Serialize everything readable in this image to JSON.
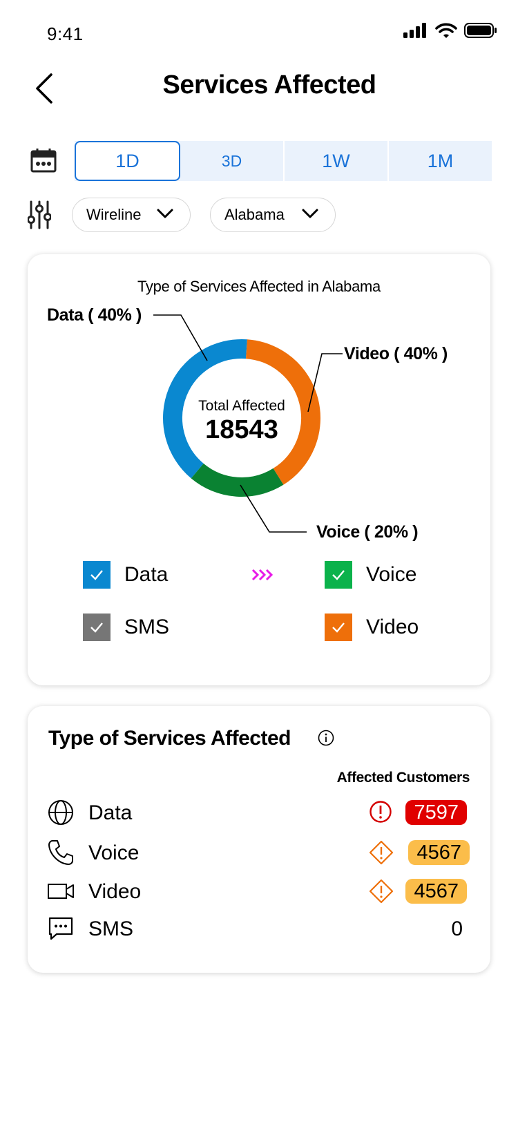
{
  "status_bar": {
    "time": "9:41"
  },
  "header": {
    "title": "Services Affected"
  },
  "time_range": {
    "tabs": [
      "1D",
      "3D",
      "1W",
      "1M"
    ],
    "selected": "1D"
  },
  "filters": {
    "network": "Wireline",
    "region": "Alabama"
  },
  "chart_card": {
    "title": "Type of Services Affected in Alabama",
    "center_label": "Total Affected",
    "center_value": "18543",
    "callouts": {
      "data": "Data ( 40% )",
      "video": "Video ( 40% )",
      "voice": "Voice ( 20% )"
    },
    "legend": [
      {
        "label": "Data",
        "color": "#0a88d0",
        "checked": true
      },
      {
        "label": "Voice",
        "color": "#0bb24b",
        "checked": true
      },
      {
        "label": "SMS",
        "color": "#767676",
        "checked": true
      },
      {
        "label": "Video",
        "color": "#ee6f0a",
        "checked": true
      }
    ],
    "colors": {
      "data": "#0a88d0",
      "video": "#ee6f0a",
      "voice": "#0a8232",
      "accent": "#e81ae8"
    }
  },
  "chart_data": {
    "type": "pie",
    "donut": true,
    "title": "Type of Services Affected in Alabama",
    "total": 18543,
    "categories": [
      "Data",
      "Video",
      "Voice"
    ],
    "values": [
      40,
      40,
      20
    ],
    "unit": "%"
  },
  "services_card": {
    "title": "Type of Services Affected",
    "column_header": "Affected Customers",
    "rows": [
      {
        "icon": "globe-icon",
        "label": "Data",
        "count": "7597",
        "severity": "critical"
      },
      {
        "icon": "phone-icon",
        "label": "Voice",
        "count": "4567",
        "severity": "warning"
      },
      {
        "icon": "video-camera-icon",
        "label": "Video",
        "count": "4567",
        "severity": "warning"
      },
      {
        "icon": "message-icon",
        "label": "SMS",
        "count": "0",
        "severity": "none"
      }
    ]
  }
}
